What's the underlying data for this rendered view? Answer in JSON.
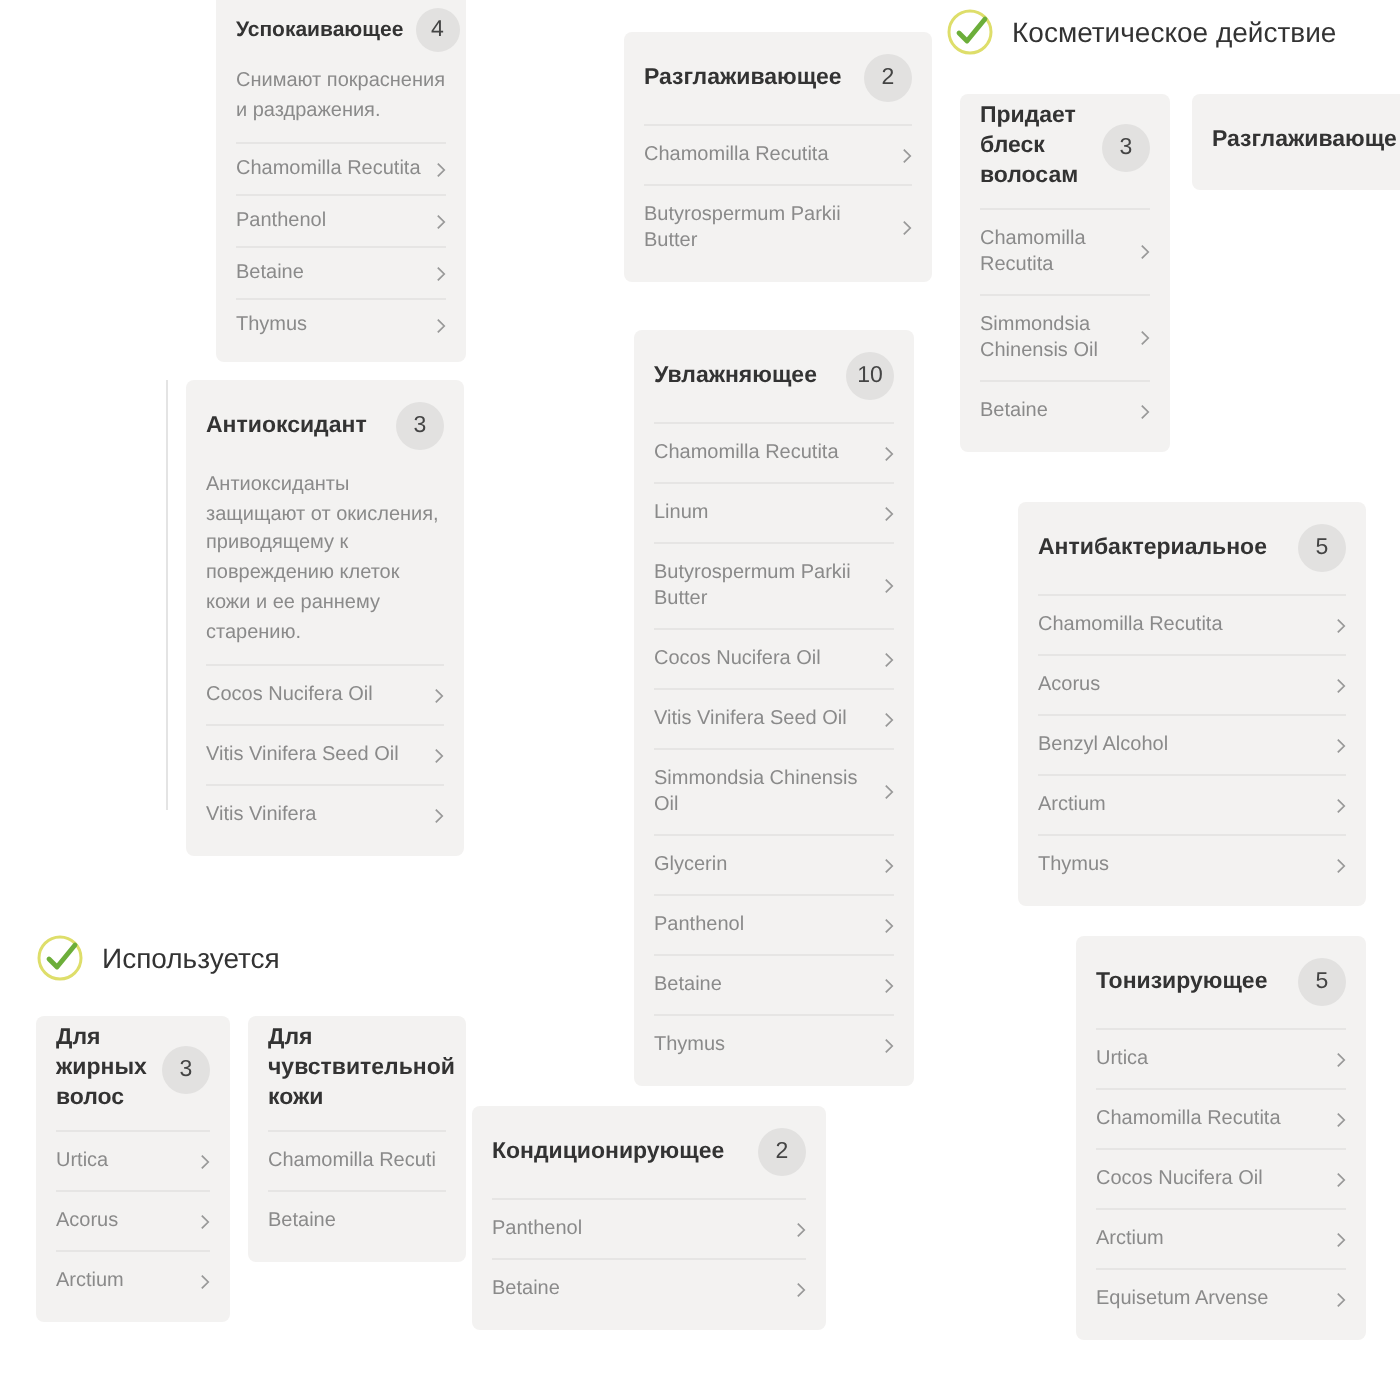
{
  "headings": [
    {
      "text": "Косметическое действие"
    },
    {
      "text": "Используется"
    }
  ],
  "cards": [
    {
      "title": "Успокаивающее",
      "count": "4",
      "description": "Снимают покраснения и раздражения.",
      "items": [
        "Chamomilla Recutita",
        "Panthenol",
        "Betaine",
        "Thymus"
      ]
    },
    {
      "title": "Антиоксидант",
      "count": "3",
      "description": "Антиоксиданты защищают от окисления, приводящему к повреждению клеток кожи и ее раннему старению.",
      "items": [
        "Cocos Nucifera Oil",
        "Vitis Vinifera Seed Oil",
        "Vitis Vinifera"
      ]
    },
    {
      "title": "Разглаживающее",
      "count": "2",
      "items": [
        "Chamomilla Recutita",
        "Butyrospermum Parkii Butter"
      ]
    },
    {
      "title": "Увлажняющее",
      "count": "10",
      "items": [
        "Chamomilla Recutita",
        "Linum",
        "Butyrospermum Parkii Butter",
        "Cocos Nucifera Oil",
        "Vitis Vinifera Seed Oil",
        "Simmondsia Chinensis Oil",
        "Glycerin",
        "Panthenol",
        "Betaine",
        "Thymus"
      ]
    },
    {
      "title": "Придает блеск волосам",
      "count": "3",
      "items": [
        "Chamomilla Recutita",
        "Simmondsia Chinensis Oil",
        "Betaine"
      ]
    },
    {
      "title": "Разглаживающе"
    },
    {
      "title": "Антибактериальное",
      "count": "5",
      "items": [
        "Chamomilla Recutita",
        "Acorus",
        "Benzyl Alcohol",
        "Arctium",
        "Thymus"
      ]
    },
    {
      "title": "Для жирных волос",
      "count": "3",
      "items": [
        "Urtica",
        "Acorus",
        "Arctium"
      ]
    },
    {
      "title": "Для чувствительной кожи",
      "items": [
        "Chamomilla Recuti",
        "Betaine"
      ]
    },
    {
      "title": "Кондиционирующее",
      "count": "2",
      "items": [
        "Panthenol",
        "Betaine"
      ]
    },
    {
      "title": "Тонизирующее",
      "count": "5",
      "items": [
        "Urtica",
        "Chamomilla Recutita",
        "Cocos Nucifera Oil",
        "Arctium",
        "Equisetum Arvense"
      ]
    }
  ]
}
